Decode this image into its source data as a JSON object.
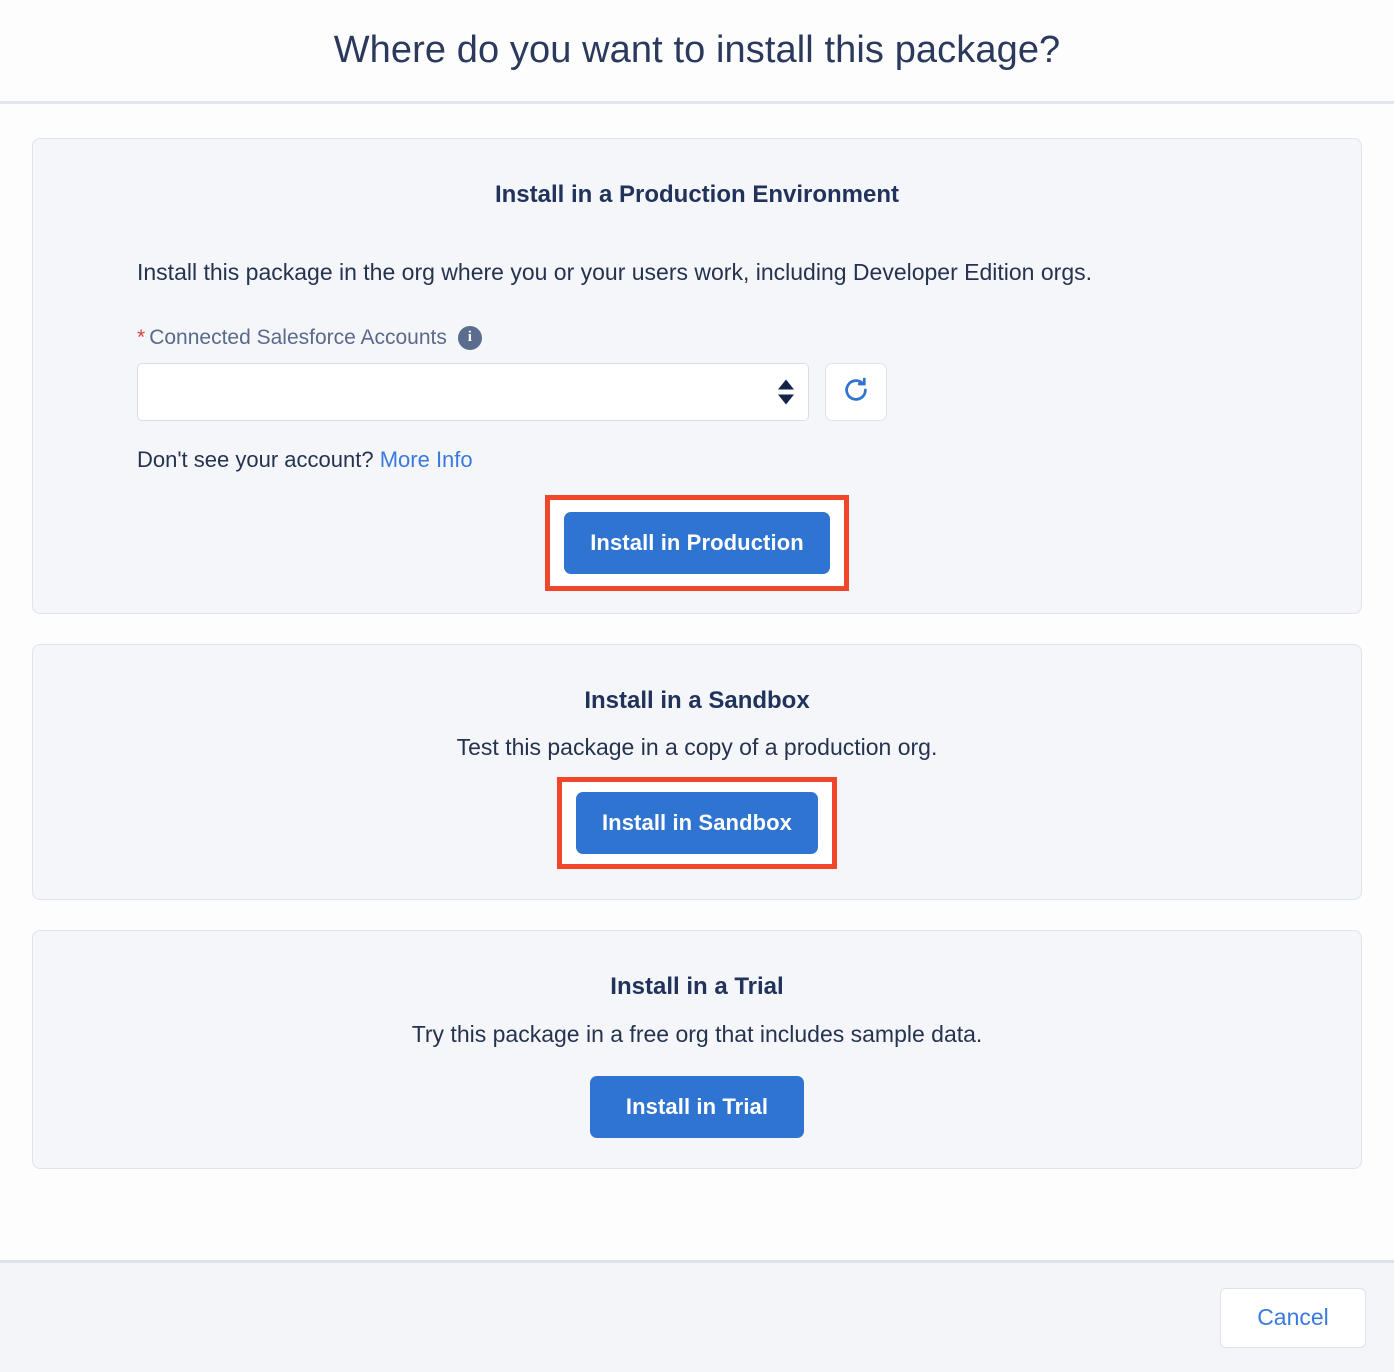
{
  "header": {
    "title": "Where do you want to install this package?"
  },
  "production": {
    "title": "Install in a Production Environment",
    "description": "Install this package in the org where you or your users work, including Developer Edition orgs.",
    "field": {
      "required_marker": "*",
      "label": "Connected Salesforce Accounts",
      "info_icon": "info-icon",
      "value": "",
      "placeholder": ""
    },
    "refresh_icon": "refresh-icon",
    "helper_text": "Don't see your account?",
    "helper_link": "More Info",
    "button_label": "Install in Production",
    "highlighted": true
  },
  "sandbox": {
    "title": "Install in a Sandbox",
    "description": "Test this package in a copy of a production org.",
    "button_label": "Install in Sandbox",
    "highlighted": true
  },
  "trial": {
    "title": "Install in a Trial",
    "description": "Try this package in a free org that includes sample data.",
    "button_label": "Install in Trial",
    "highlighted": false
  },
  "footer": {
    "cancel_label": "Cancel"
  },
  "colors": {
    "primary_button": "#2f74d0",
    "link": "#3a7ae0",
    "annotation_highlight": "#f0462a",
    "heading": "#21325b",
    "required_star": "#d1453b",
    "card_background": "#f4f6fa",
    "info_icon": "#5b6d8f"
  }
}
